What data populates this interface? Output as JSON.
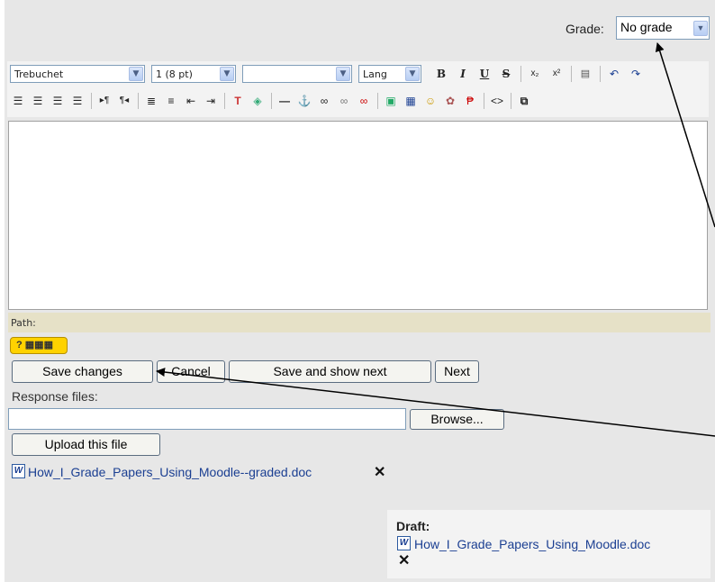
{
  "grade": {
    "label": "Grade:",
    "value": "No grade"
  },
  "toolbar": {
    "font_family": "Trebuchet",
    "font_size": "1 (8 pt)",
    "format": "",
    "lang": "Lang",
    "bold": "B",
    "italic": "I",
    "underline": "U",
    "strike": "S"
  },
  "path_label": "Path:",
  "keyboard_icon_text": "?",
  "buttons": {
    "save_changes": "Save changes",
    "cancel": "Cancel",
    "save_and_show_next": "Save and show next",
    "next": "Next",
    "browse": "Browse...",
    "upload": "Upload this file"
  },
  "response_files_label": "Response files:",
  "response_file": {
    "name": "How_I_Grade_Papers_Using_Moodle--graded.doc",
    "delete": "✕"
  },
  "draft": {
    "label": "Draft:",
    "file": "How_I_Grade_Papers_Using_Moodle.doc",
    "delete": "✕"
  }
}
